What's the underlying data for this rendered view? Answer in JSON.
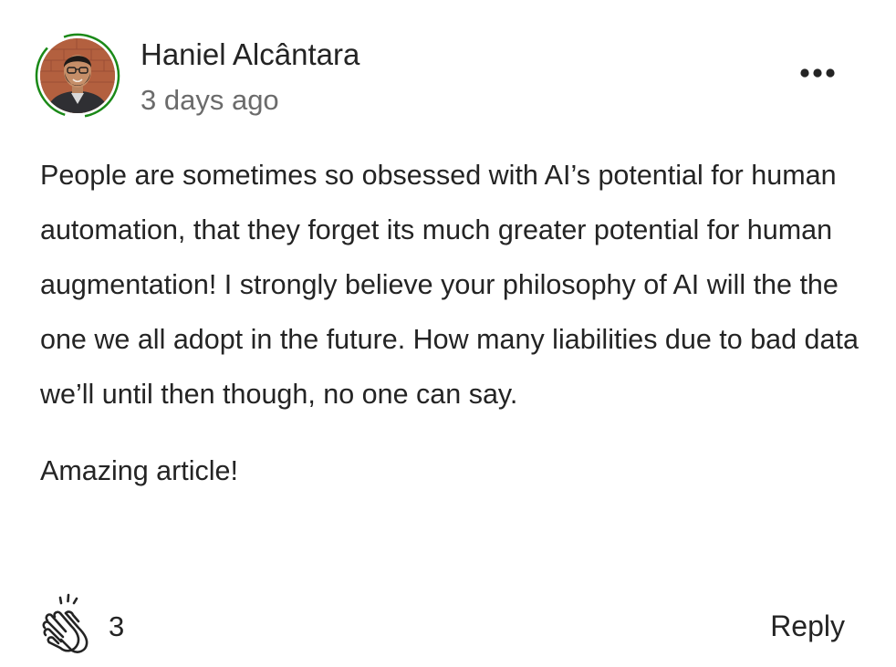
{
  "comment": {
    "author": {
      "name": "Haniel Alcântara",
      "avatar_icon": "user-photo-avatar",
      "ring_color": "#1a8917"
    },
    "timestamp": "3 days ago",
    "more_icon": "ellipsis-icon",
    "paragraphs": [
      "People are sometimes so obsessed with AI’s potential for human automation, that they forget its much greater potential for human augmentation! I strongly believe your philosophy of AI will the the one we all adopt in the future. How many liabilities due to bad data we’ll until then though, no one can say.",
      "Amazing article!"
    ],
    "footer": {
      "clap_icon": "clap-icon",
      "clap_count": "3",
      "reply_label": "Reply"
    }
  }
}
